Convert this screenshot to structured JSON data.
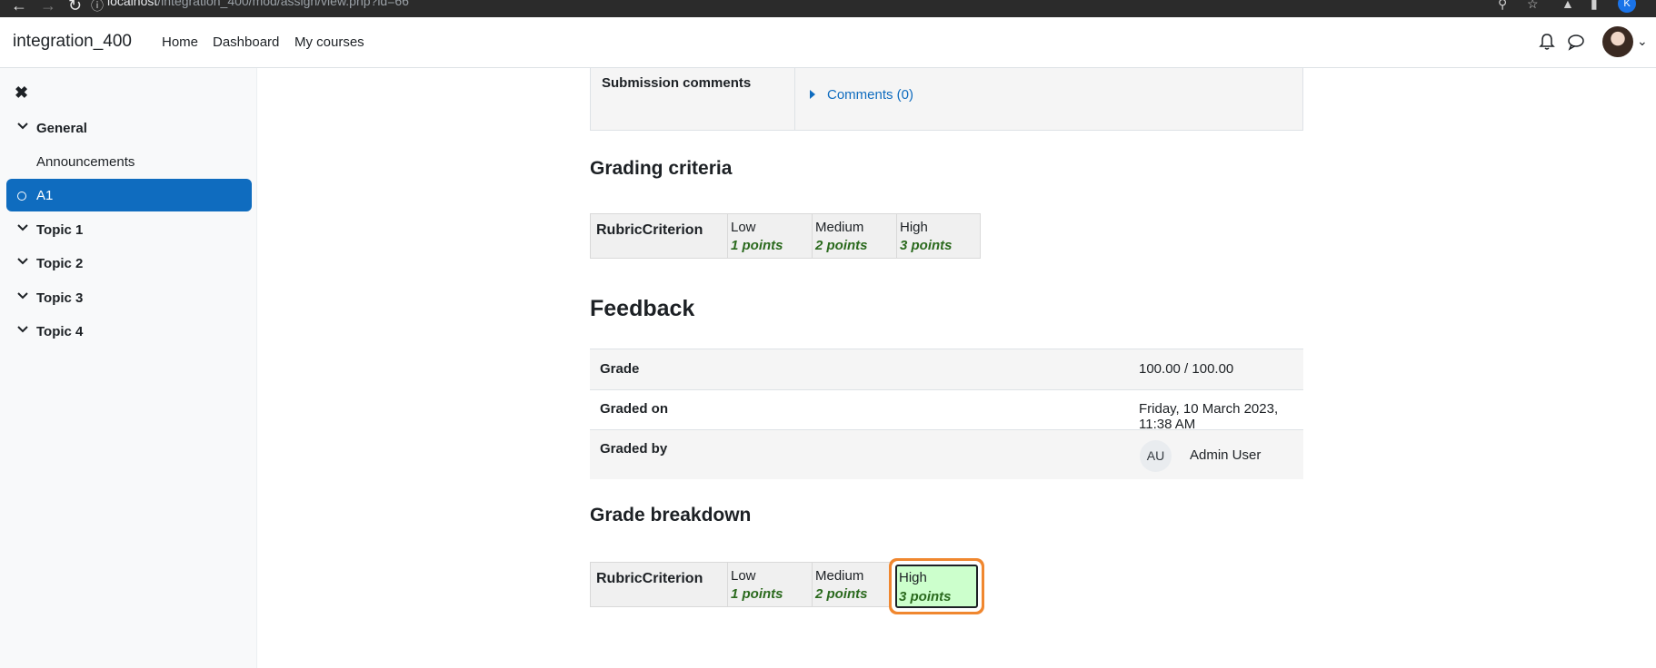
{
  "browser": {
    "url_host": "localhost",
    "url_path": "/integration_400/mod/assign/view.php?id=66",
    "profile_letter": "K"
  },
  "navbar": {
    "site_name": "integration_400",
    "links": [
      "Home",
      "Dashboard",
      "My courses"
    ]
  },
  "sidebar": {
    "items": [
      {
        "label": "General",
        "type": "section"
      },
      {
        "label": "Announcements",
        "type": "activity"
      },
      {
        "label": "A1",
        "type": "activity",
        "active": true
      },
      {
        "label": "Topic 1",
        "type": "section"
      },
      {
        "label": "Topic 2",
        "type": "section"
      },
      {
        "label": "Topic 3",
        "type": "section"
      },
      {
        "label": "Topic 4",
        "type": "section"
      }
    ]
  },
  "submission": {
    "comments_label": "Submission comments",
    "comments_link": "Comments (0)"
  },
  "grading_criteria": {
    "title": "Grading criteria",
    "criterion": "RubricCriterion",
    "levels": [
      {
        "definition": "Low",
        "points": "1 points"
      },
      {
        "definition": "Medium",
        "points": "2 points"
      },
      {
        "definition": "High",
        "points": "3 points"
      }
    ]
  },
  "feedback": {
    "title": "Feedback",
    "rows": [
      {
        "key": "Grade",
        "value": "100.00 / 100.00"
      },
      {
        "key": "Graded on",
        "value": "Friday, 10 March 2023, 11:38 AM"
      },
      {
        "key": "Graded by",
        "initials": "AU",
        "value": "Admin User"
      }
    ]
  },
  "grade_breakdown": {
    "title": "Grade breakdown",
    "criterion": "RubricCriterion",
    "levels": [
      {
        "definition": "Low",
        "points": "1 points"
      },
      {
        "definition": "Medium",
        "points": "2 points"
      },
      {
        "definition": "High",
        "points": "3 points",
        "selected": true
      }
    ]
  },
  "colors": {
    "primary": "#0f6cbf",
    "points_green": "#2b6a1e",
    "selected_fill": "#ccffcc",
    "highlight_ring": "#f0872f"
  }
}
